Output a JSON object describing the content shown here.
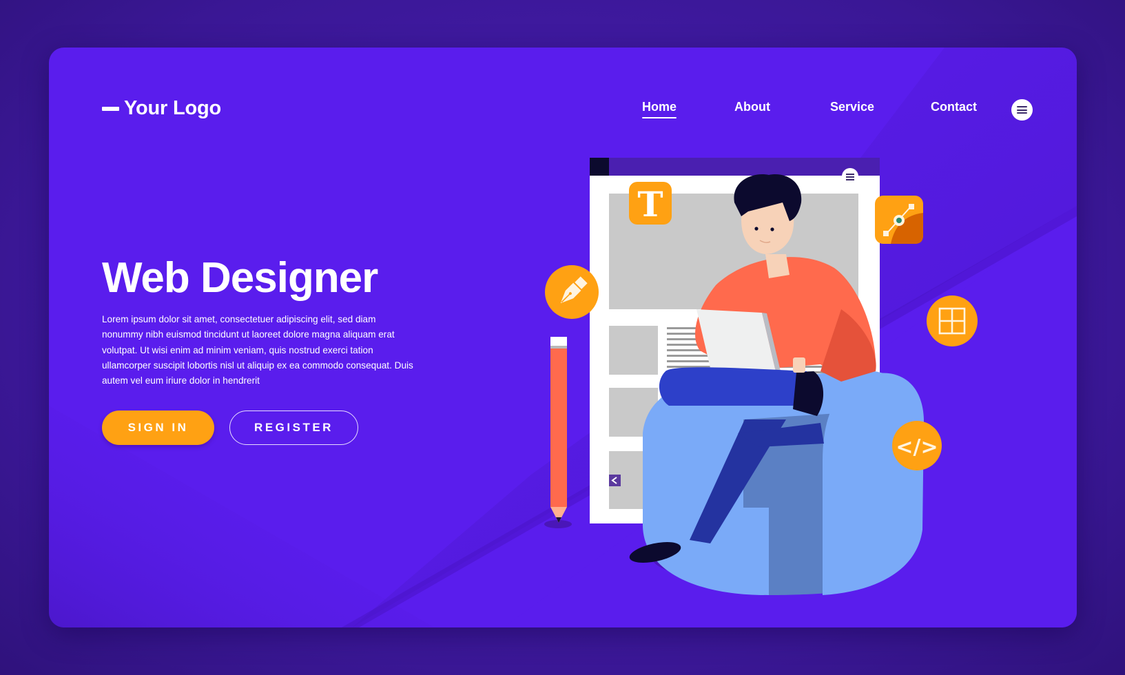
{
  "header": {
    "logo_text": "Your Logo",
    "nav": [
      {
        "label": "Home",
        "active": true
      },
      {
        "label": "About",
        "active": false
      },
      {
        "label": "Service",
        "active": false
      },
      {
        "label": "Contact",
        "active": false
      }
    ],
    "menu_icon": "hamburger-menu-icon"
  },
  "hero": {
    "title": "Web Designer",
    "body": "Lorem ipsum dolor sit amet, consectetuer adipiscing elit, sed diam nonummy nibh euismod tincidunt ut laoreet dolore magna aliquam erat volutpat. Ut wisi enim ad minim veniam, quis nostrud exerci tation ullamcorper suscipit lobortis nisl ut aliquip ex ea commodo consequat. Duis autem vel eum iriure dolor in hendrerit",
    "primary_button": "SIGN IN",
    "secondary_button": "REGISTER"
  },
  "illustration": {
    "floating_icons": [
      "text-tool-icon",
      "pen-tool-icon",
      "bezier-node-icon",
      "grid-layout-icon",
      "code-brackets-icon"
    ],
    "code_glyph": "</>",
    "text_glyph": "T"
  },
  "colors": {
    "page_bg": "#3d1a9e",
    "card_bg": "#5a1ded",
    "accent_orange": "#ffa113",
    "shirt": "#ff6a4d",
    "chair": "#7aaaf8",
    "pants": "#2433a0",
    "mock_gray": "#c9c9c9"
  }
}
